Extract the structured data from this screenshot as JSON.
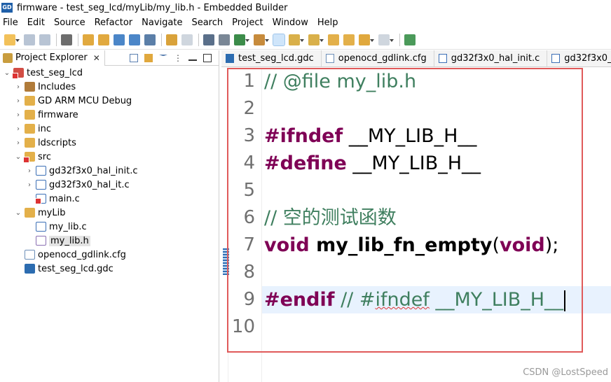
{
  "window": {
    "title": "firmware - test_seg_lcd/myLib/my_lib.h - Embedded Builder",
    "app_icon_text": "GD"
  },
  "menu": [
    "File",
    "Edit",
    "Source",
    "Refactor",
    "Navigate",
    "Search",
    "Project",
    "Window",
    "Help"
  ],
  "explorer": {
    "tab_label": "Project Explorer",
    "close_glyph": "✕",
    "tree": [
      {
        "label": "test_seg_lcd",
        "arrow": "⌄",
        "icon": "project-icon",
        "error": true
      },
      {
        "label": "Includes",
        "arrow": "›",
        "icon": "includes-icon"
      },
      {
        "label": "GD ARM MCU Debug",
        "arrow": "›",
        "icon": "folder-icon"
      },
      {
        "label": "firmware",
        "arrow": "›",
        "icon": "folder-icon"
      },
      {
        "label": "inc",
        "arrow": "›",
        "icon": "folder-icon"
      },
      {
        "label": "ldscripts",
        "arrow": "›",
        "icon": "folder-icon"
      },
      {
        "label": "src",
        "arrow": "⌄",
        "icon": "folder-icon",
        "error": true
      },
      {
        "label": "gd32f3x0_hal_init.c",
        "arrow": "›",
        "icon": "c-file-icon"
      },
      {
        "label": "gd32f3x0_hal_it.c",
        "arrow": "›",
        "icon": "c-file-icon"
      },
      {
        "label": "main.c",
        "arrow": "",
        "icon": "c-file-icon",
        "error": true
      },
      {
        "label": "myLib",
        "arrow": "⌄",
        "icon": "folder-icon"
      },
      {
        "label": "my_lib.c",
        "arrow": "",
        "icon": "c-file-icon"
      },
      {
        "label": "my_lib.h",
        "arrow": "",
        "icon": "h-file-icon",
        "selected": true
      },
      {
        "label": "openocd_gdlink.cfg",
        "arrow": "",
        "icon": "cfg-file-icon"
      },
      {
        "label": "test_seg_lcd.gdc",
        "arrow": "",
        "icon": "gdc-file-icon"
      }
    ]
  },
  "editor": {
    "tabs": [
      "test_seg_lcd.gdc",
      "openocd_gdlink.cfg",
      "gd32f3x0_hal_init.c",
      "gd32f3x0_h"
    ],
    "line_numbers": [
      "1",
      "2",
      "3",
      "4",
      "5",
      "6",
      "7",
      "8",
      "9",
      "10"
    ],
    "code": {
      "l1": "// @file my_lib.h",
      "l3_kw": "#ifndef",
      "l3_rest": " __MY_LIB_H__",
      "l4_kw": "#define",
      "l4_rest": " __MY_LIB_H__",
      "l6": "// 空的测试函数",
      "l7_kw1": "void",
      "l7_fn": " my_lib_fn_empty",
      "l7_p1": "(",
      "l7_kw2": "void",
      "l7_p2": ");",
      "l9_kw": "#endif",
      "l9_c1": " // #",
      "l9_sq": "ifndef",
      "l9_c2": " __MY_LIB_H__"
    }
  },
  "watermark": "CSDN @LostSpeed",
  "colors": {
    "keyword": "#7f0055",
    "comment": "#3f7f5f",
    "highlight_box": "#e05a5a",
    "current_line": "#e8f2fe"
  }
}
